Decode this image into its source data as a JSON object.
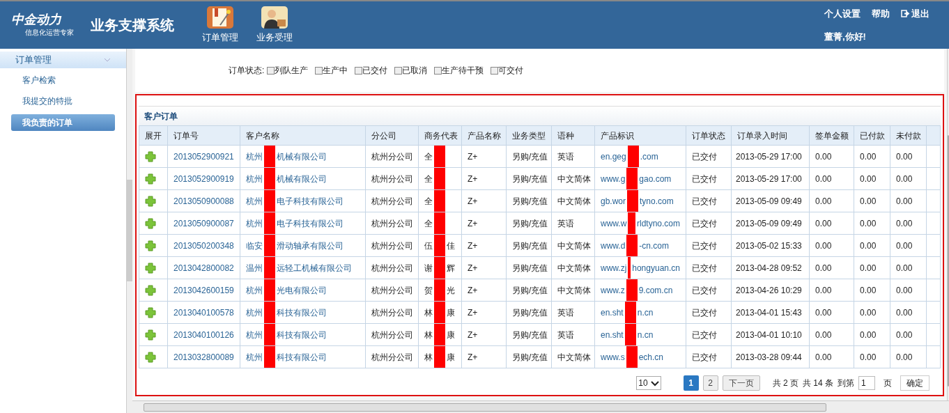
{
  "header": {
    "logo": {
      "name": "中金动力",
      "tagline": "信息化运营专家"
    },
    "system_title": "业务支撑系统",
    "nav": [
      {
        "label": "订单管理",
        "kind": "order"
      },
      {
        "label": "业务受理",
        "kind": "person"
      }
    ],
    "links": [
      {
        "label": "个人设置",
        "kind": "text"
      },
      {
        "label": "帮助",
        "kind": "text"
      },
      {
        "label": "退出",
        "kind": "exit"
      }
    ],
    "greeting": "董菁,你好!"
  },
  "sidebar": {
    "section": {
      "label": "订单管理",
      "expanded": true
    },
    "items": [
      {
        "label": "客户检索",
        "selected": false
      },
      {
        "label": "我提交的特批",
        "selected": false
      },
      {
        "label": "我负责的订单",
        "selected": true
      }
    ]
  },
  "filter": {
    "label": "订单状态:",
    "options": [
      {
        "label": "列队生产",
        "checked": false
      },
      {
        "label": "生产中",
        "checked": false
      },
      {
        "label": "已交付",
        "checked": false
      },
      {
        "label": "已取消",
        "checked": false
      },
      {
        "label": "生产待干预",
        "checked": false
      },
      {
        "label": "可交付",
        "checked": false
      }
    ]
  },
  "table": {
    "title": "客户订单",
    "columns": [
      "展开",
      "订单号",
      "客户名称",
      "分公司",
      "商务代表",
      "产品名称",
      "业务类型",
      "语种",
      "产品标识",
      "订单状态",
      "订单录入时间",
      "签单金额",
      "已付款",
      "未付款"
    ],
    "rows": [
      {
        "order": "2013052900921",
        "customer": [
          "杭州",
          "机械有限公司"
        ],
        "branch": "杭州分公司",
        "rep": [
          "全"
        ],
        "product": "Z+",
        "type": "另购/充值",
        "language": "英语",
        "product_id": [
          "en.geg",
          ".com"
        ],
        "status": "已交付",
        "time": "2013-05-29 17:00",
        "amount": "0.00",
        "paid": "0.00",
        "unpaid": "0.00"
      },
      {
        "order": "2013052900919",
        "customer": [
          "杭州",
          "机械有限公司"
        ],
        "branch": "杭州分公司",
        "rep": [
          "全"
        ],
        "product": "Z+",
        "type": "另购/充值",
        "language": "中文简体",
        "product_id": [
          "www.g",
          "gao.com"
        ],
        "status": "已交付",
        "time": "2013-05-29 17:00",
        "amount": "0.00",
        "paid": "0.00",
        "unpaid": "0.00"
      },
      {
        "order": "2013050900088",
        "customer": [
          "杭州",
          "电子科技有限公司"
        ],
        "branch": "杭州分公司",
        "rep": [
          "全"
        ],
        "product": "Z+",
        "type": "另购/充值",
        "language": "中文简体",
        "product_id": [
          "gb.wor",
          "tyno.com"
        ],
        "status": "已交付",
        "time": "2013-05-09 09:49",
        "amount": "0.00",
        "paid": "0.00",
        "unpaid": "0.00"
      },
      {
        "order": "2013050900087",
        "customer": [
          "杭州",
          "电子科技有限公司"
        ],
        "branch": "杭州分公司",
        "rep": [
          "全"
        ],
        "product": "Z+",
        "type": "另购/充值",
        "language": "英语",
        "product_id": [
          "www.w",
          "rldtyno.com"
        ],
        "status": "已交付",
        "time": "2013-05-09 09:49",
        "amount": "0.00",
        "paid": "0.00",
        "unpaid": "0.00"
      },
      {
        "order": "2013050200348",
        "customer": [
          "临安",
          "滑动轴承有限公司"
        ],
        "branch": "杭州分公司",
        "rep": [
          "伍",
          "佳"
        ],
        "product": "Z+",
        "type": "另购/充值",
        "language": "中文简体",
        "product_id": [
          "www.d",
          "-cn.com"
        ],
        "status": "已交付",
        "time": "2013-05-02 15:33",
        "amount": "0.00",
        "paid": "0.00",
        "unpaid": "0.00"
      },
      {
        "order": "2013042800082",
        "customer": [
          "温州",
          "远轻工机械有限公司"
        ],
        "branch": "杭州分公司",
        "rep": [
          "谢",
          "辉"
        ],
        "product": "Z+",
        "type": "另购/充值",
        "language": "中文简体",
        "product_id": [
          "www.zj",
          "hongyuan.cn"
        ],
        "status": "已交付",
        "time": "2013-04-28 09:52",
        "amount": "0.00",
        "paid": "0.00",
        "unpaid": "0.00"
      },
      {
        "order": "2013042600159",
        "customer": [
          "杭州",
          "光电有限公司"
        ],
        "branch": "杭州分公司",
        "rep": [
          "贺",
          "光"
        ],
        "product": "Z+",
        "type": "另购/充值",
        "language": "中文简体",
        "product_id": [
          "www.z",
          "9.com.cn"
        ],
        "status": "已交付",
        "time": "2013-04-26 10:29",
        "amount": "0.00",
        "paid": "0.00",
        "unpaid": "0.00"
      },
      {
        "order": "2013040100578",
        "customer": [
          "杭州",
          "科技有限公司"
        ],
        "branch": "杭州分公司",
        "rep": [
          "林",
          "康"
        ],
        "product": "Z+",
        "type": "另购/充值",
        "language": "英语",
        "product_id": [
          "en.sht",
          "n.cn"
        ],
        "status": "已交付",
        "time": "2013-04-01 15:43",
        "amount": "0.00",
        "paid": "0.00",
        "unpaid": "0.00"
      },
      {
        "order": "2013040100126",
        "customer": [
          "杭州",
          "科技有限公司"
        ],
        "branch": "杭州分公司",
        "rep": [
          "林",
          "康"
        ],
        "product": "Z+",
        "type": "另购/充值",
        "language": "英语",
        "product_id": [
          "en.sht",
          "n.cn"
        ],
        "status": "已交付",
        "time": "2013-04-01 10:10",
        "amount": "0.00",
        "paid": "0.00",
        "unpaid": "0.00"
      },
      {
        "order": "2013032800089",
        "customer": [
          "杭州",
          "科技有限公司"
        ],
        "branch": "杭州分公司",
        "rep": [
          "林",
          "康"
        ],
        "product": "Z+",
        "type": "另购/充值",
        "language": "中文简体",
        "product_id": [
          "www.s",
          "ech.cn"
        ],
        "status": "已交付",
        "time": "2013-03-28 09:44",
        "amount": "0.00",
        "paid": "0.00",
        "unpaid": "0.00"
      }
    ]
  },
  "pagination": {
    "page_size": "10",
    "pages": [
      {
        "label": "1",
        "selected": true
      },
      {
        "label": "2",
        "selected": false
      }
    ],
    "next": "下一页",
    "total_pages": "共 2 页",
    "total_items": "共 14 条",
    "goto_label": "到第",
    "goto_value": "1",
    "page_unit": "页",
    "confirm": "确定"
  }
}
